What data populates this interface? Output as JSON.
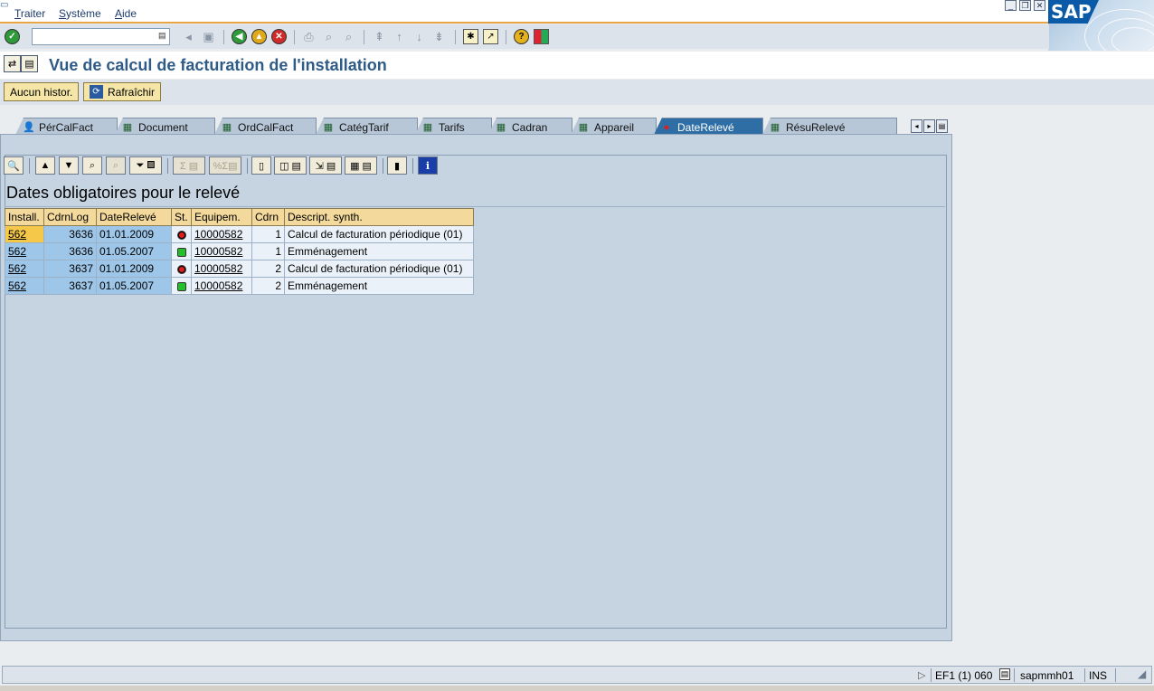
{
  "menu": {
    "items": [
      "Traiter",
      "Système",
      "Aide"
    ]
  },
  "brand": {
    "logo_text": "SAP"
  },
  "toolbar": {
    "command_value": ""
  },
  "title": {
    "text": "Vue de calcul de facturation de l'installation"
  },
  "app_toolbar": {
    "no_history": "Aucun histor.",
    "refresh": "Rafraîchir"
  },
  "tabs": [
    {
      "label": "PérCalFact",
      "icon": "person-icon"
    },
    {
      "label": "Document",
      "icon": "table-icon"
    },
    {
      "label": "OrdCalFact",
      "icon": "table-icon"
    },
    {
      "label": "CatégTarif",
      "icon": "table-icon"
    },
    {
      "label": "Tarifs",
      "icon": "table-icon"
    },
    {
      "label": "Cadran",
      "icon": "table-icon"
    },
    {
      "label": "Appareil",
      "icon": "table-icon"
    },
    {
      "label": "DateRelevé",
      "icon": "red-light-icon",
      "active": true
    },
    {
      "label": "RésuRelevé",
      "icon": "table-icon"
    }
  ],
  "grid": {
    "title": "Dates obligatoires pour le relevé",
    "columns": [
      "Install.",
      "CdrnLog",
      "DateRelevé",
      "St.",
      "Equipem.",
      "Cdrn",
      "Descript. synth."
    ],
    "rows": [
      {
        "install": "562",
        "cdrnlog": "3636",
        "date": "01.01.2009",
        "status": "red",
        "equip": "10000582",
        "cdrn": "1",
        "desc": "Calcul de facturation périodique (01)"
      },
      {
        "install": "562",
        "cdrnlog": "3636",
        "date": "01.05.2007",
        "status": "green",
        "equip": "10000582",
        "cdrn": "1",
        "desc": "Emménagement"
      },
      {
        "install": "562",
        "cdrnlog": "3637",
        "date": "01.01.2009",
        "status": "red",
        "equip": "10000582",
        "cdrn": "2",
        "desc": "Calcul de facturation périodique (01)"
      },
      {
        "install": "562",
        "cdrnlog": "3637",
        "date": "01.05.2007",
        "status": "green",
        "equip": "10000582",
        "cdrn": "2",
        "desc": "Emménagement"
      }
    ]
  },
  "status": {
    "system": "EF1 (1) 060",
    "server": "sapmmh01",
    "mode": "INS"
  }
}
